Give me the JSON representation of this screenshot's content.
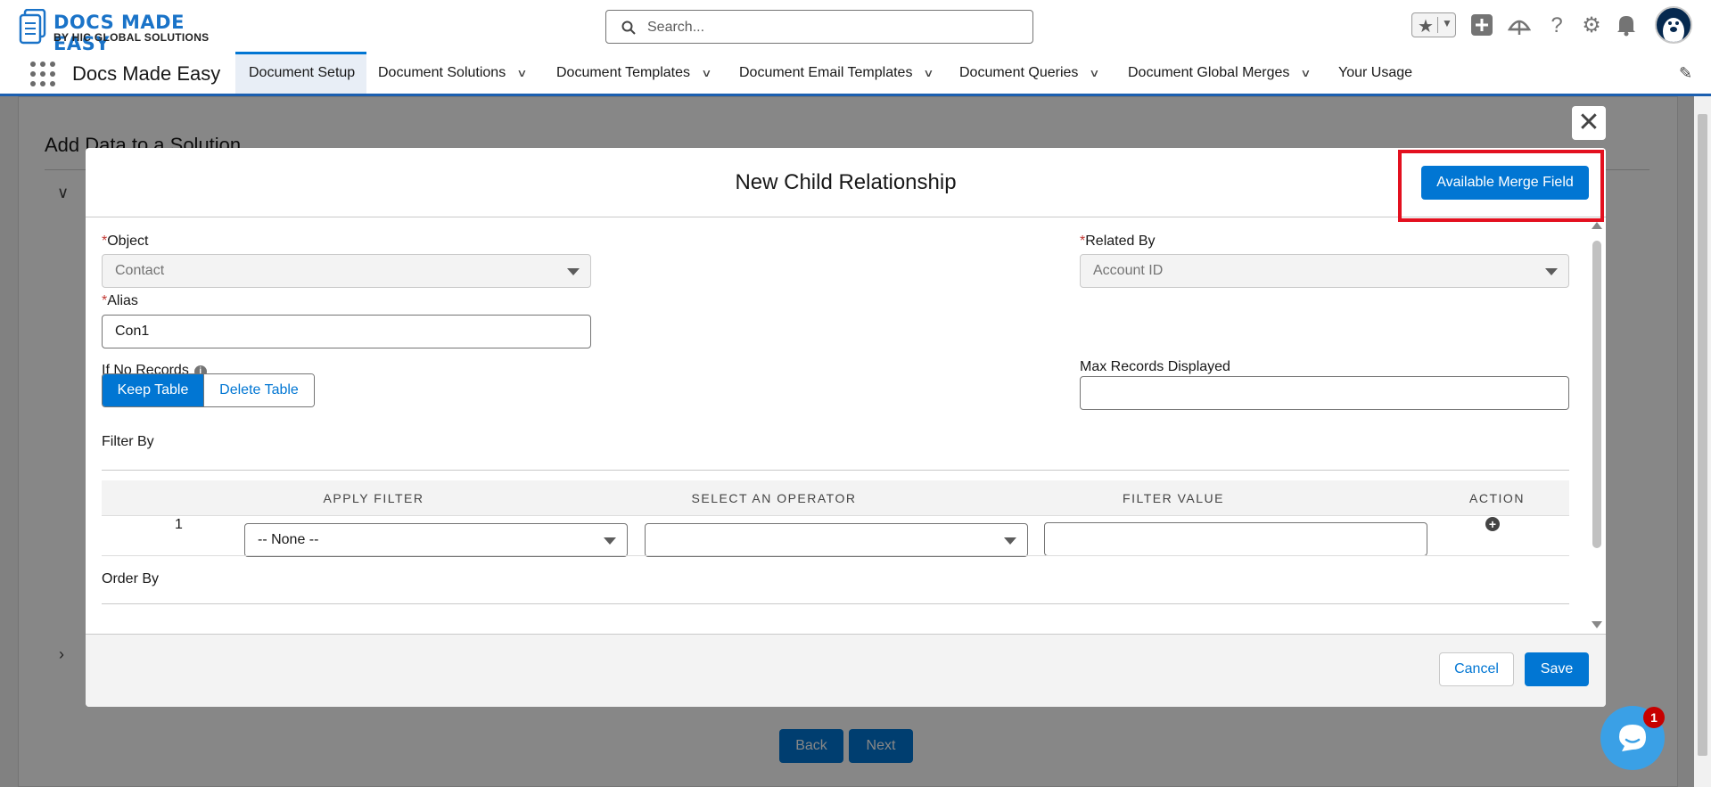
{
  "brand": {
    "line1": "DOCS MADE EASY",
    "line2": "BY HIC GLOBAL SOLUTIONS"
  },
  "search": {
    "placeholder": "Search..."
  },
  "nav": {
    "app_name": "Docs Made Easy",
    "tabs": [
      {
        "label": "Document Setup",
        "active": true,
        "has_menu": false
      },
      {
        "label": "Document Solutions",
        "has_menu": true
      },
      {
        "label": "Document Templates",
        "has_menu": true
      },
      {
        "label": "Document Email Templates",
        "has_menu": true
      },
      {
        "label": "Document Queries",
        "has_menu": true
      },
      {
        "label": "Document Global Merges",
        "has_menu": true
      },
      {
        "label": "Your Usage",
        "has_menu": false
      }
    ]
  },
  "background_page": {
    "title": "Add Data to a Solution",
    "back_label": "Back",
    "next_label": "Next"
  },
  "modal": {
    "title": "New Child Relationship",
    "merge_field_button": "Available Merge Field",
    "object": {
      "label": "Object",
      "value": "Contact"
    },
    "related_by": {
      "label": "Related By",
      "value": "Account ID"
    },
    "alias": {
      "label": "Alias",
      "value": "Con1"
    },
    "if_no_records": {
      "label": "If No Records",
      "options": [
        "Keep Table",
        "Delete Table"
      ],
      "selected": "Keep Table"
    },
    "max_records": {
      "label": "Max Records Displayed",
      "value": ""
    },
    "filter_by": {
      "label": "Filter By",
      "columns": [
        "APPLY FILTER",
        "SELECT AN OPERATOR",
        "FILTER VALUE",
        "ACTION"
      ],
      "rows": [
        {
          "num": "1",
          "filter": "-- None --",
          "operator": "",
          "value": ""
        }
      ]
    },
    "order_by": {
      "label": "Order By"
    },
    "cancel_label": "Cancel",
    "save_label": "Save"
  },
  "chat": {
    "badge": "1"
  },
  "colors": {
    "brand_blue": "#0176d3",
    "highlight_red": "#e3101f",
    "nav_accent": "#1b5fb0"
  },
  "icons": [
    "search-icon",
    "star-icon",
    "plus-icon",
    "trailhead-icon",
    "help-icon",
    "gear-icon",
    "bell-icon",
    "avatar",
    "app-launcher-icon",
    "edit-nav-icon",
    "close-icon",
    "info-icon",
    "add-row-icon",
    "chat-icon"
  ]
}
